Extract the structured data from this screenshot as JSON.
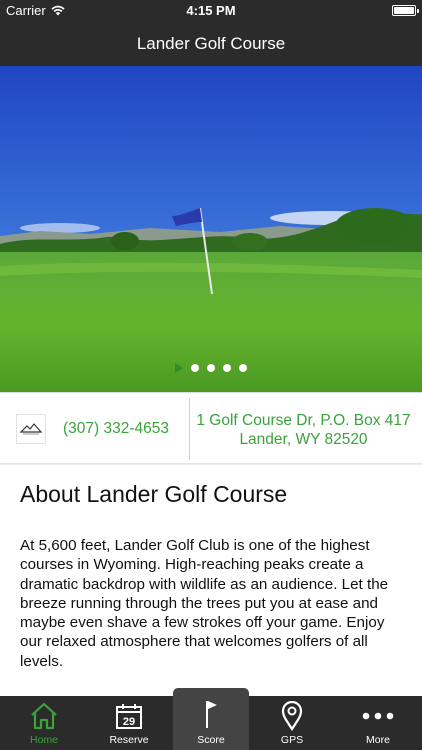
{
  "status_bar": {
    "carrier": "Carrier",
    "time": "4:15 PM"
  },
  "nav": {
    "title": "Lander Golf Course"
  },
  "slideshow": {
    "slide_count": 5,
    "active_index": 0
  },
  "contact": {
    "phone": "(307) 332-4653",
    "address_line1": "1 Golf Course Dr, P.O. Box 417",
    "address_line2": "Lander, WY 82520"
  },
  "about": {
    "title": "About Lander Golf Course",
    "body": "At 5,600 feet, Lander Golf Club is one of the highest courses in Wyoming. High-reaching peaks create a dramatic backdrop with wildlife as an audience. Let the breeze running through the trees put you at ease and maybe even shave a few strokes off your game. Enjoy our relaxed atmosphere that welcomes golfers of all levels."
  },
  "tabs": [
    {
      "label": "Home",
      "icon": "home-icon",
      "active": true
    },
    {
      "label": "Reserve",
      "icon": "calendar-icon",
      "day": "29"
    },
    {
      "label": "Score",
      "icon": "flag-icon"
    },
    {
      "label": "GPS",
      "icon": "location-pin-icon"
    },
    {
      "label": "More",
      "icon": "more-dots-icon"
    }
  ],
  "colors": {
    "accent": "#3aa33a",
    "bar": "#2b2b2b",
    "score_tab": "#444444"
  }
}
